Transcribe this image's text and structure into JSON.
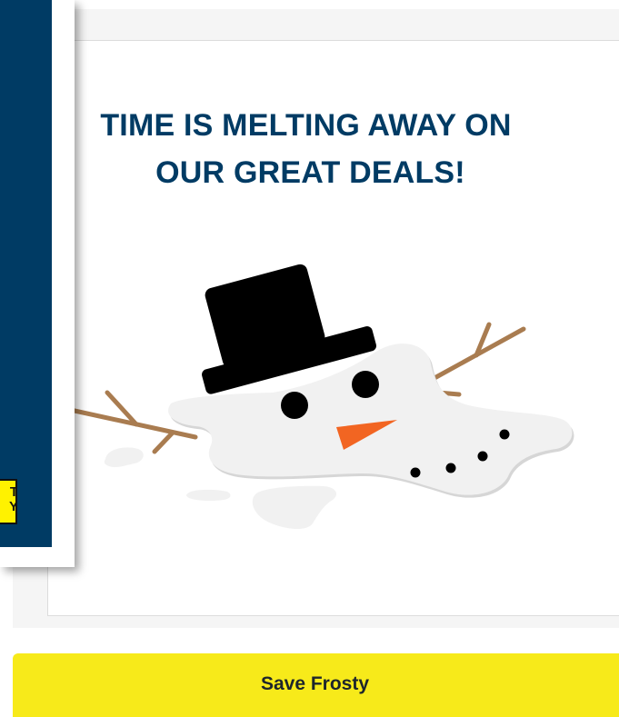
{
  "promo": {
    "headline_line1": "TIME IS MELTING AWAY ON",
    "headline_line2": "OUR GREAT DEALS!",
    "illustration": "melting-snowman",
    "colors": {
      "headline": "#003b64",
      "side_panel": "#003b64",
      "cta_background": "#f7ea1a",
      "carrot_nose": "#f26522",
      "twig_arms": "#a97c50",
      "snow": "#f1f1f1"
    }
  },
  "side_card": {
    "logo_text_line1": "T",
    "logo_text_line2": "Y"
  },
  "cta": {
    "label": "Save Frosty"
  }
}
